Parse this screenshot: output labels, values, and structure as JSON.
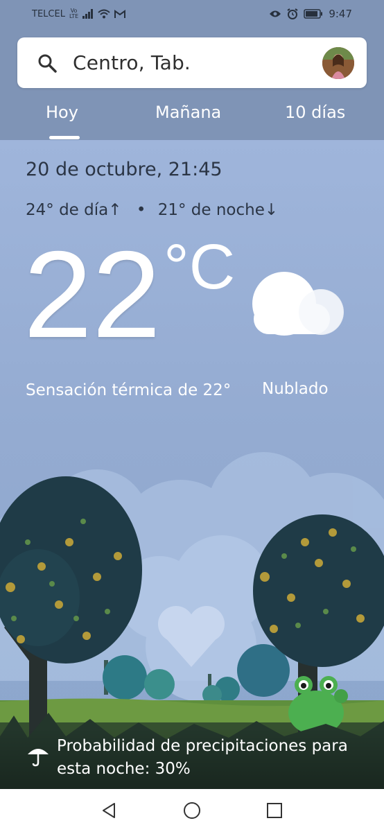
{
  "status_bar": {
    "carrier": "TELCEL",
    "volte_top": "Vo",
    "volte_bottom": "LTE",
    "time": "9:47",
    "icons": [
      "signal-icon",
      "wifi-icon",
      "gmail-icon",
      "eye-icon",
      "alarm-icon",
      "battery-icon"
    ]
  },
  "search": {
    "location": "Centro, Tab.",
    "icon": "search-icon"
  },
  "tabs": [
    {
      "label": "Hoy",
      "selected": true
    },
    {
      "label": "Mañana",
      "selected": false
    },
    {
      "label": "10 días",
      "selected": false
    }
  ],
  "weather": {
    "datetime": "20 de octubre, 21:45",
    "high_label": "24° de día",
    "high_arrow": "↑",
    "separator": "•",
    "low_label": "21° de noche",
    "low_arrow": "↓",
    "temperature": "22",
    "unit": "°C",
    "feels_like": "Sensación térmica de 22°",
    "condition": "Nublado",
    "condition_icon": "cloud-icon"
  },
  "precipitation": {
    "text": "Probabilidad de precipitaciones para esta noche: 30%",
    "icon": "umbrella-icon"
  },
  "nav": [
    "back-icon",
    "home-icon",
    "recents-icon"
  ],
  "colors": {
    "header_bg": "#7f94b6",
    "sky": "#9fb5db",
    "text_dark": "#2b3545",
    "white": "#ffffff",
    "tree_dark": "#1f3f4a",
    "frog_green": "#4caf50"
  }
}
